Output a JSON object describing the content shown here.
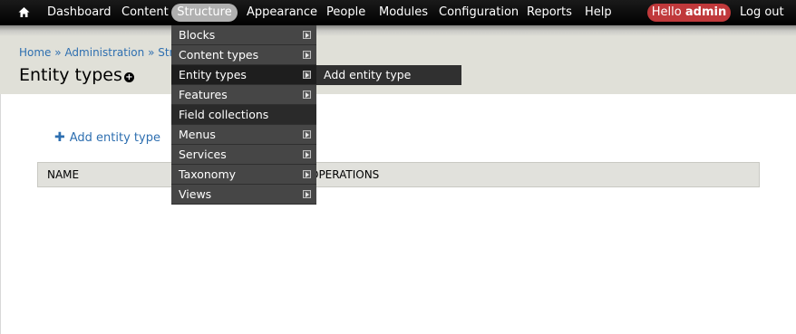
{
  "toolbar": {
    "items": [
      {
        "label": "Dashboard"
      },
      {
        "label": "Content"
      },
      {
        "label": "Structure"
      },
      {
        "label": "Appearance"
      },
      {
        "label": "People"
      },
      {
        "label": "Modules"
      },
      {
        "label": "Configuration"
      },
      {
        "label": "Reports"
      },
      {
        "label": "Help"
      }
    ],
    "hello_prefix": "Hello",
    "hello_user": "admin",
    "logout": "Log out",
    "home_icon": "home-icon"
  },
  "breadcrumb": {
    "home": "Home",
    "sep1": "»",
    "admin": "Administration",
    "sep2": "»",
    "structure": "Struct"
  },
  "page": {
    "title": "Entity types",
    "add_link": "Add entity type",
    "add_plus": "✚"
  },
  "table": {
    "col_name": "NAME",
    "col_operations": "OPERATIONS"
  },
  "structure_menu": {
    "items": [
      {
        "label": "Blocks"
      },
      {
        "label": "Content types"
      },
      {
        "label": "Entity types"
      },
      {
        "label": "Features"
      },
      {
        "label": "Field collections"
      },
      {
        "label": "Menus"
      },
      {
        "label": "Services"
      },
      {
        "label": "Taxonomy"
      },
      {
        "label": "Views"
      }
    ],
    "submenu_label": "Add entity type"
  },
  "colors": {
    "toolbar_bg": "#000000",
    "active_pill": "#b0b0b0",
    "hello_pill": "#c0393b",
    "link": "#2e6fb0",
    "header_bg": "#e0e0d8"
  }
}
